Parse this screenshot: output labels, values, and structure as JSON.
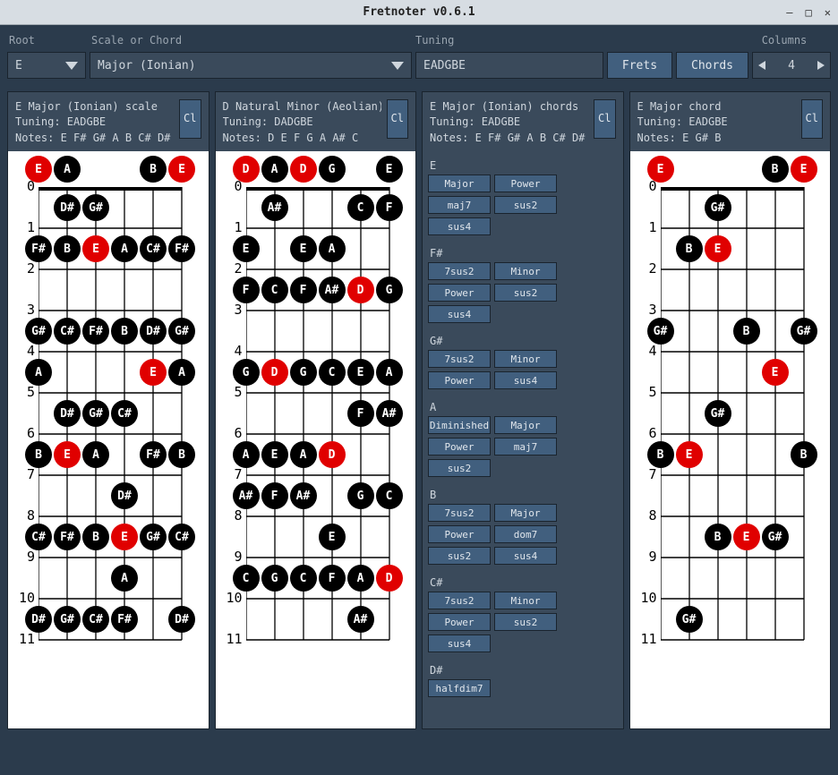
{
  "window": {
    "title": "Fretnoter v0.6.1"
  },
  "toolbar": {
    "labels": {
      "root": "Root",
      "scale": "Scale or Chord",
      "tuning": "Tuning",
      "columns": "Columns"
    },
    "root_value": "E",
    "scale_value": "Major (Ionian)",
    "tuning_value": "EADGBE",
    "frets_button": "Frets",
    "chords_button": "Chords",
    "columns_value": "4"
  },
  "panels": [
    {
      "id": "p1",
      "kind": "fretboard",
      "title": "E Major (Ionian) scale",
      "tuning": "Tuning: EADGBE",
      "notes": "Notes: E F# G# A B C# D#",
      "cl": "Cl",
      "strings": 6,
      "frets": 11,
      "root_note": "E",
      "dots": [
        {
          "s": 0,
          "f": -1,
          "n": "E",
          "r": true
        },
        {
          "s": 1,
          "f": -1,
          "n": "A"
        },
        {
          "s": 4,
          "f": -1,
          "n": "B"
        },
        {
          "s": 5,
          "f": -1,
          "n": "E",
          "r": true
        },
        {
          "s": 1,
          "f": 0,
          "n": "D#"
        },
        {
          "s": 2,
          "f": 0,
          "n": "G#"
        },
        {
          "s": 0,
          "f": 1,
          "n": "F#"
        },
        {
          "s": 1,
          "f": 1,
          "n": "B"
        },
        {
          "s": 2,
          "f": 1,
          "n": "E",
          "r": true
        },
        {
          "s": 3,
          "f": 1,
          "n": "A"
        },
        {
          "s": 4,
          "f": 1,
          "n": "C#"
        },
        {
          "s": 5,
          "f": 1,
          "n": "F#"
        },
        {
          "s": 0,
          "f": 3,
          "n": "G#"
        },
        {
          "s": 1,
          "f": 3,
          "n": "C#"
        },
        {
          "s": 2,
          "f": 3,
          "n": "F#"
        },
        {
          "s": 3,
          "f": 3,
          "n": "B"
        },
        {
          "s": 4,
          "f": 3,
          "n": "D#"
        },
        {
          "s": 5,
          "f": 3,
          "n": "G#"
        },
        {
          "s": 0,
          "f": 4,
          "n": "A"
        },
        {
          "s": 4,
          "f": 4,
          "n": "E",
          "r": true
        },
        {
          "s": 5,
          "f": 4,
          "n": "A"
        },
        {
          "s": 1,
          "f": 5,
          "n": "D#"
        },
        {
          "s": 2,
          "f": 5,
          "n": "G#"
        },
        {
          "s": 3,
          "f": 5,
          "n": "C#"
        },
        {
          "s": 0,
          "f": 6,
          "n": "B"
        },
        {
          "s": 1,
          "f": 6,
          "n": "E",
          "r": true
        },
        {
          "s": 2,
          "f": 6,
          "n": "A"
        },
        {
          "s": 4,
          "f": 6,
          "n": "F#"
        },
        {
          "s": 5,
          "f": 6,
          "n": "B"
        },
        {
          "s": 3,
          "f": 7,
          "n": "D#"
        },
        {
          "s": 0,
          "f": 8,
          "n": "C#"
        },
        {
          "s": 1,
          "f": 8,
          "n": "F#"
        },
        {
          "s": 2,
          "f": 8,
          "n": "B"
        },
        {
          "s": 3,
          "f": 8,
          "n": "E",
          "r": true
        },
        {
          "s": 4,
          "f": 8,
          "n": "G#"
        },
        {
          "s": 5,
          "f": 8,
          "n": "C#"
        },
        {
          "s": 3,
          "f": 9,
          "n": "A"
        },
        {
          "s": 0,
          "f": 10,
          "n": "D#"
        },
        {
          "s": 1,
          "f": 10,
          "n": "G#"
        },
        {
          "s": 2,
          "f": 10,
          "n": "C#"
        },
        {
          "s": 3,
          "f": 10,
          "n": "F#"
        },
        {
          "s": 5,
          "f": 10,
          "n": "D#"
        }
      ]
    },
    {
      "id": "p2",
      "kind": "fretboard",
      "title": "D Natural Minor (Aeolian) s",
      "tuning": "Tuning: DADGBE",
      "notes": "Notes: D E F G A A# C",
      "cl": "Cl",
      "strings": 6,
      "frets": 11,
      "root_note": "D",
      "dots": [
        {
          "s": 0,
          "f": -1,
          "n": "D",
          "r": true
        },
        {
          "s": 1,
          "f": -1,
          "n": "A"
        },
        {
          "s": 2,
          "f": -1,
          "n": "D",
          "r": true
        },
        {
          "s": 3,
          "f": -1,
          "n": "G"
        },
        {
          "s": 5,
          "f": -1,
          "n": "E"
        },
        {
          "s": 1,
          "f": 0,
          "n": "A#"
        },
        {
          "s": 4,
          "f": 0,
          "n": "C"
        },
        {
          "s": 5,
          "f": 0,
          "n": "F"
        },
        {
          "s": 0,
          "f": 1,
          "n": "E"
        },
        {
          "s": 2,
          "f": 1,
          "n": "E"
        },
        {
          "s": 3,
          "f": 1,
          "n": "A"
        },
        {
          "s": 0,
          "f": 2,
          "n": "F"
        },
        {
          "s": 1,
          "f": 2,
          "n": "C"
        },
        {
          "s": 2,
          "f": 2,
          "n": "F"
        },
        {
          "s": 3,
          "f": 2,
          "n": "A#"
        },
        {
          "s": 4,
          "f": 2,
          "n": "D",
          "r": true
        },
        {
          "s": 5,
          "f": 2,
          "n": "G"
        },
        {
          "s": 0,
          "f": 4,
          "n": "G"
        },
        {
          "s": 1,
          "f": 4,
          "n": "D",
          "r": true
        },
        {
          "s": 2,
          "f": 4,
          "n": "G"
        },
        {
          "s": 3,
          "f": 4,
          "n": "C"
        },
        {
          "s": 4,
          "f": 4,
          "n": "E"
        },
        {
          "s": 5,
          "f": 4,
          "n": "A"
        },
        {
          "s": 4,
          "f": 5,
          "n": "F"
        },
        {
          "s": 5,
          "f": 5,
          "n": "A#"
        },
        {
          "s": 0,
          "f": 6,
          "n": "A"
        },
        {
          "s": 1,
          "f": 6,
          "n": "E"
        },
        {
          "s": 2,
          "f": 6,
          "n": "A"
        },
        {
          "s": 3,
          "f": 6,
          "n": "D",
          "r": true
        },
        {
          "s": 0,
          "f": 7,
          "n": "A#"
        },
        {
          "s": 1,
          "f": 7,
          "n": "F"
        },
        {
          "s": 2,
          "f": 7,
          "n": "A#"
        },
        {
          "s": 4,
          "f": 7,
          "n": "G"
        },
        {
          "s": 5,
          "f": 7,
          "n": "C"
        },
        {
          "s": 3,
          "f": 8,
          "n": "E"
        },
        {
          "s": 0,
          "f": 9,
          "n": "C"
        },
        {
          "s": 1,
          "f": 9,
          "n": "G"
        },
        {
          "s": 2,
          "f": 9,
          "n": "C"
        },
        {
          "s": 3,
          "f": 9,
          "n": "F"
        },
        {
          "s": 4,
          "f": 9,
          "n": "A"
        },
        {
          "s": 5,
          "f": 9,
          "n": "D",
          "r": true
        },
        {
          "s": 4,
          "f": 10,
          "n": "A#"
        }
      ]
    },
    {
      "id": "p3",
      "kind": "chords",
      "title": "E Major (Ionian) chords",
      "tuning": "Tuning: EADGBE",
      "notes": "Notes: E F# G# A B C# D#",
      "cl": "Cl",
      "groups": [
        {
          "root": "E",
          "chips": [
            "Major",
            "Power",
            "maj7",
            "sus2",
            "sus4"
          ]
        },
        {
          "root": "F#",
          "chips": [
            "7sus2",
            "Minor",
            "Power",
            "sus2",
            "sus4"
          ]
        },
        {
          "root": "G#",
          "chips": [
            "7sus2",
            "Minor",
            "Power",
            "sus4"
          ]
        },
        {
          "root": "A",
          "chips": [
            "Diminished",
            "Major",
            "Power",
            "maj7",
            "sus2"
          ]
        },
        {
          "root": "B",
          "chips": [
            "7sus2",
            "Major",
            "Power",
            "dom7",
            "sus2",
            "sus4"
          ]
        },
        {
          "root": "C#",
          "chips": [
            "7sus2",
            "Minor",
            "Power",
            "sus2",
            "sus4"
          ]
        },
        {
          "root": "D#",
          "chips": [
            "halfdim7"
          ]
        }
      ]
    },
    {
      "id": "p4",
      "kind": "fretboard",
      "title": "E Major chord",
      "tuning": "Tuning: EADGBE",
      "notes": "Notes: E G# B",
      "cl": "Cl",
      "strings": 6,
      "frets": 11,
      "root_note": "E",
      "dots": [
        {
          "s": 0,
          "f": -1,
          "n": "E",
          "r": true
        },
        {
          "s": 4,
          "f": -1,
          "n": "B"
        },
        {
          "s": 5,
          "f": -1,
          "n": "E",
          "r": true
        },
        {
          "s": 2,
          "f": 0,
          "n": "G#"
        },
        {
          "s": 1,
          "f": 1,
          "n": "B"
        },
        {
          "s": 2,
          "f": 1,
          "n": "E",
          "r": true
        },
        {
          "s": 0,
          "f": 3,
          "n": "G#"
        },
        {
          "s": 3,
          "f": 3,
          "n": "B"
        },
        {
          "s": 5,
          "f": 3,
          "n": "G#"
        },
        {
          "s": 4,
          "f": 4,
          "n": "E",
          "r": true
        },
        {
          "s": 2,
          "f": 5,
          "n": "G#"
        },
        {
          "s": 0,
          "f": 6,
          "n": "B"
        },
        {
          "s": 1,
          "f": 6,
          "n": "E",
          "r": true
        },
        {
          "s": 5,
          "f": 6,
          "n": "B"
        },
        {
          "s": 2,
          "f": 8,
          "n": "B"
        },
        {
          "s": 3,
          "f": 8,
          "n": "E",
          "r": true
        },
        {
          "s": 4,
          "f": 8,
          "n": "G#"
        },
        {
          "s": 1,
          "f": 10,
          "n": "G#"
        }
      ]
    }
  ]
}
